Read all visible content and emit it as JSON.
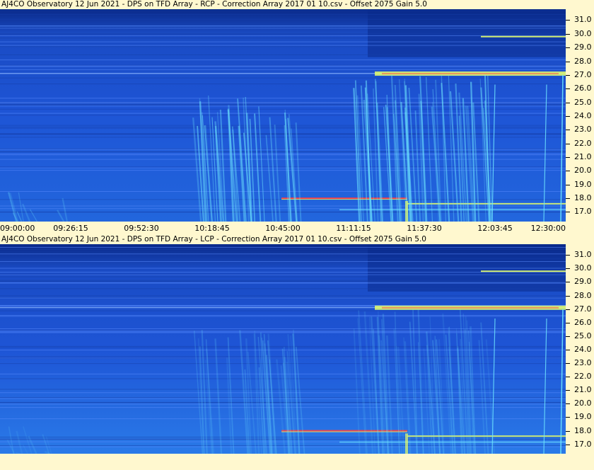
{
  "panels": [
    {
      "title": "AJ4CO Observatory 12 Jun 2021  -  DPS on TFD Array  -  RCP  -  Correction Array 2017 01 10.csv  -  Offset 2075  Gain 5.0",
      "polarization": "RCP"
    },
    {
      "title": "AJ4CO Observatory 12 Jun 2021  -  DPS on TFD Array  -  LCP  -  Correction Array 2017 01 10.csv  -  Offset 2075  Gain 5.0",
      "polarization": "LCP"
    }
  ],
  "chart_data": {
    "type": "heatmap",
    "x_ticks": [
      "09:00:00",
      "09:26:15",
      "09:52:30",
      "10:18:45",
      "10:45:00",
      "11:11:15",
      "11:37:30",
      "12:03:45",
      "12:30:00"
    ],
    "xlim": [
      "09:00:00",
      "12:30:00"
    ],
    "y_ticks": [
      "31.0",
      "30.0",
      "29.0",
      "28.0",
      "27.0",
      "26.0",
      "25.0",
      "24.0",
      "23.0",
      "22.0",
      "21.0",
      "20.0",
      "19.0",
      "18.0",
      "17.0"
    ],
    "ylim": [
      16.3,
      31.8
    ],
    "colors": {
      "background": "#1e55d6",
      "dark": "#0a2a8a",
      "bright": "#6fe8ff",
      "hot": "#e6ff6a",
      "red": "#ff4040"
    }
  }
}
